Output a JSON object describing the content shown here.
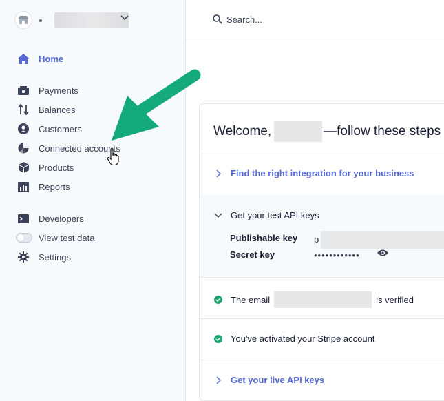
{
  "sidebar": {
    "home": "Home",
    "group1": [
      "Payments",
      "Balances",
      "Customers",
      "Connected accounts",
      "Products",
      "Reports"
    ],
    "developers": "Developers",
    "test_data": "View test data",
    "settings": "Settings"
  },
  "search": {
    "placeholder": "Search..."
  },
  "welcome": {
    "prefix": "Welcome,",
    "suffix": "—follow these steps"
  },
  "steps": {
    "integration": "Find the right integration for your business",
    "test_keys": "Get your test API keys",
    "publishable_label": "Publishable key",
    "publishable_value": "p",
    "secret_label": "Secret key",
    "secret_value": "••••••••••••",
    "email_prefix": "The email",
    "email_suffix": "is verified",
    "activated": "You've activated your Stripe account",
    "live_keys": "Get your live API keys"
  },
  "colors": {
    "accent": "#5469d4",
    "success": "#1ea672",
    "annotation": "#13a97d"
  }
}
